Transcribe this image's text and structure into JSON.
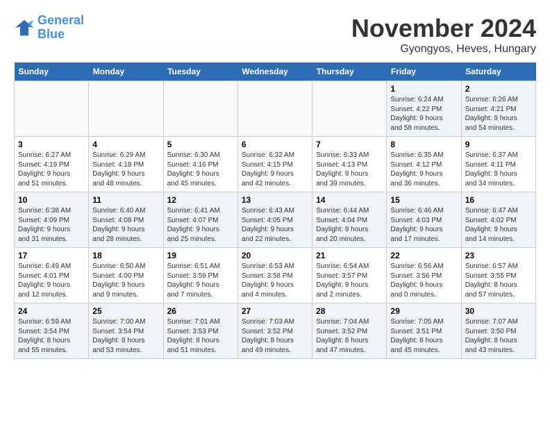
{
  "logo": {
    "line1": "General",
    "line2": "Blue"
  },
  "title": "November 2024",
  "location": "Gyongyos, Heves, Hungary",
  "weekdays": [
    "Sunday",
    "Monday",
    "Tuesday",
    "Wednesday",
    "Thursday",
    "Friday",
    "Saturday"
  ],
  "weeks": [
    [
      {
        "day": "",
        "info": ""
      },
      {
        "day": "",
        "info": ""
      },
      {
        "day": "",
        "info": ""
      },
      {
        "day": "",
        "info": ""
      },
      {
        "day": "",
        "info": ""
      },
      {
        "day": "1",
        "info": "Sunrise: 6:24 AM\nSunset: 4:22 PM\nDaylight: 9 hours\nand 58 minutes."
      },
      {
        "day": "2",
        "info": "Sunrise: 6:26 AM\nSunset: 4:21 PM\nDaylight: 9 hours\nand 54 minutes."
      }
    ],
    [
      {
        "day": "3",
        "info": "Sunrise: 6:27 AM\nSunset: 4:19 PM\nDaylight: 9 hours\nand 51 minutes."
      },
      {
        "day": "4",
        "info": "Sunrise: 6:29 AM\nSunset: 4:18 PM\nDaylight: 9 hours\nand 48 minutes."
      },
      {
        "day": "5",
        "info": "Sunrise: 6:30 AM\nSunset: 4:16 PM\nDaylight: 9 hours\nand 45 minutes."
      },
      {
        "day": "6",
        "info": "Sunrise: 6:32 AM\nSunset: 4:15 PM\nDaylight: 9 hours\nand 42 minutes."
      },
      {
        "day": "7",
        "info": "Sunrise: 6:33 AM\nSunset: 4:13 PM\nDaylight: 9 hours\nand 39 minutes."
      },
      {
        "day": "8",
        "info": "Sunrise: 6:35 AM\nSunset: 4:12 PM\nDaylight: 9 hours\nand 36 minutes."
      },
      {
        "day": "9",
        "info": "Sunrise: 6:37 AM\nSunset: 4:11 PM\nDaylight: 9 hours\nand 34 minutes."
      }
    ],
    [
      {
        "day": "10",
        "info": "Sunrise: 6:38 AM\nSunset: 4:09 PM\nDaylight: 9 hours\nand 31 minutes."
      },
      {
        "day": "11",
        "info": "Sunrise: 6:40 AM\nSunset: 4:08 PM\nDaylight: 9 hours\nand 28 minutes."
      },
      {
        "day": "12",
        "info": "Sunrise: 6:41 AM\nSunset: 4:07 PM\nDaylight: 9 hours\nand 25 minutes."
      },
      {
        "day": "13",
        "info": "Sunrise: 6:43 AM\nSunset: 4:05 PM\nDaylight: 9 hours\nand 22 minutes."
      },
      {
        "day": "14",
        "info": "Sunrise: 6:44 AM\nSunset: 4:04 PM\nDaylight: 9 hours\nand 20 minutes."
      },
      {
        "day": "15",
        "info": "Sunrise: 6:46 AM\nSunset: 4:03 PM\nDaylight: 9 hours\nand 17 minutes."
      },
      {
        "day": "16",
        "info": "Sunrise: 6:47 AM\nSunset: 4:02 PM\nDaylight: 9 hours\nand 14 minutes."
      }
    ],
    [
      {
        "day": "17",
        "info": "Sunrise: 6:49 AM\nSunset: 4:01 PM\nDaylight: 9 hours\nand 12 minutes."
      },
      {
        "day": "18",
        "info": "Sunrise: 6:50 AM\nSunset: 4:00 PM\nDaylight: 9 hours\nand 9 minutes."
      },
      {
        "day": "19",
        "info": "Sunrise: 6:51 AM\nSunset: 3:59 PM\nDaylight: 9 hours\nand 7 minutes."
      },
      {
        "day": "20",
        "info": "Sunrise: 6:53 AM\nSunset: 3:58 PM\nDaylight: 9 hours\nand 4 minutes."
      },
      {
        "day": "21",
        "info": "Sunrise: 6:54 AM\nSunset: 3:57 PM\nDaylight: 9 hours\nand 2 minutes."
      },
      {
        "day": "22",
        "info": "Sunrise: 6:56 AM\nSunset: 3:56 PM\nDaylight: 9 hours\nand 0 minutes."
      },
      {
        "day": "23",
        "info": "Sunrise: 6:57 AM\nSunset: 3:55 PM\nDaylight: 8 hours\nand 57 minutes."
      }
    ],
    [
      {
        "day": "24",
        "info": "Sunrise: 6:59 AM\nSunset: 3:54 PM\nDaylight: 8 hours\nand 55 minutes."
      },
      {
        "day": "25",
        "info": "Sunrise: 7:00 AM\nSunset: 3:54 PM\nDaylight: 8 hours\nand 53 minutes."
      },
      {
        "day": "26",
        "info": "Sunrise: 7:01 AM\nSunset: 3:53 PM\nDaylight: 8 hours\nand 51 minutes."
      },
      {
        "day": "27",
        "info": "Sunrise: 7:03 AM\nSunset: 3:52 PM\nDaylight: 8 hours\nand 49 minutes."
      },
      {
        "day": "28",
        "info": "Sunrise: 7:04 AM\nSunset: 3:52 PM\nDaylight: 8 hours\nand 47 minutes."
      },
      {
        "day": "29",
        "info": "Sunrise: 7:05 AM\nSunset: 3:51 PM\nDaylight: 8 hours\nand 45 minutes."
      },
      {
        "day": "30",
        "info": "Sunrise: 7:07 AM\nSunset: 3:50 PM\nDaylight: 8 hours\nand 43 minutes."
      }
    ]
  ]
}
